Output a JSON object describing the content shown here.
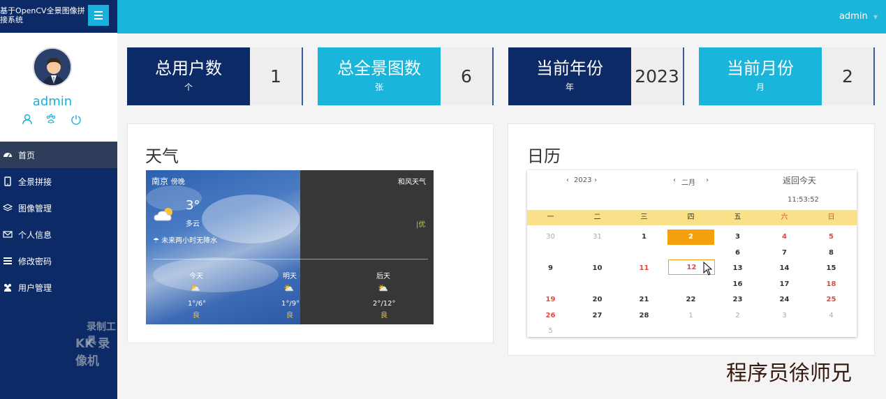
{
  "app": {
    "brand_title": "基于OpenCV全景图像拼接系统",
    "username": "admin"
  },
  "header": {
    "admin_menu": "admin"
  },
  "sidebar": {
    "items": [
      {
        "label": "首页",
        "icon": "dashboard-icon"
      },
      {
        "label": "全景拼接",
        "icon": "mobile-icon"
      },
      {
        "label": "图像管理",
        "icon": "layers-icon"
      },
      {
        "label": "个人信息",
        "icon": "envelope-icon"
      },
      {
        "label": "修改密码",
        "icon": "list-icon"
      },
      {
        "label": "用户管理",
        "icon": "users-icon"
      }
    ],
    "watermark_line1": "录制工具",
    "watermark_line2": "KK 录像机"
  },
  "stats": [
    {
      "label": "总用户数",
      "unit": "个",
      "value": "1",
      "color": "#0c2a66"
    },
    {
      "label": "总全景图数",
      "unit": "张",
      "value": "6",
      "color": "#19b5da"
    },
    {
      "label": "当前年份",
      "unit": "年",
      "value": "2023",
      "color": "#0c2a66"
    },
    {
      "label": "当前月份",
      "unit": "月",
      "value": "2",
      "color": "#19b5da"
    }
  ],
  "weather": {
    "panel_title": "天气",
    "city": "南京",
    "period": "傍晚",
    "provider": "和风天气",
    "temp": "3°",
    "condition": "多云",
    "rain_note": "未来两小时无降水",
    "aqi": "优",
    "forecast": [
      {
        "day": "今天",
        "range": "1°/6°",
        "aqi": "良"
      },
      {
        "day": "明天",
        "range": "1°/9°",
        "aqi": "良"
      },
      {
        "day": "后天",
        "range": "2°/12°",
        "aqi": "良"
      }
    ]
  },
  "calendar": {
    "panel_title": "日历",
    "year": "2023",
    "month": "二月",
    "back_today": "返回今天",
    "time": "11:53:52",
    "weekdays": [
      "一",
      "二",
      "三",
      "四",
      "五",
      "六",
      "日"
    ],
    "cells": [
      {
        "d": "30",
        "t": "other"
      },
      {
        "d": "31",
        "t": "other"
      },
      {
        "d": "1",
        "t": ""
      },
      {
        "d": "2",
        "t": "today"
      },
      {
        "d": "3",
        "t": ""
      },
      {
        "d": "4",
        "t": "weekend"
      },
      {
        "d": "5",
        "t": "weekend"
      },
      {
        "d": "6",
        "t": ""
      },
      {
        "d": "7",
        "t": ""
      },
      {
        "d": "8",
        "t": ""
      },
      {
        "d": "9",
        "t": ""
      },
      {
        "d": "10",
        "t": ""
      },
      {
        "d": "11",
        "t": "weekend"
      },
      {
        "d": "12",
        "t": "selected"
      },
      {
        "d": "13",
        "t": ""
      },
      {
        "d": "14",
        "t": ""
      },
      {
        "d": "15",
        "t": ""
      },
      {
        "d": "16",
        "t": ""
      },
      {
        "d": "17",
        "t": ""
      },
      {
        "d": "18",
        "t": "weekend"
      },
      {
        "d": "19",
        "t": "weekend"
      },
      {
        "d": "20",
        "t": ""
      },
      {
        "d": "21",
        "t": ""
      },
      {
        "d": "22",
        "t": ""
      },
      {
        "d": "23",
        "t": ""
      },
      {
        "d": "24",
        "t": ""
      },
      {
        "d": "25",
        "t": "weekend"
      },
      {
        "d": "26",
        "t": "weekend"
      },
      {
        "d": "27",
        "t": ""
      },
      {
        "d": "28",
        "t": ""
      },
      {
        "d": "1",
        "t": "other"
      },
      {
        "d": "2",
        "t": "other"
      },
      {
        "d": "3",
        "t": "other"
      },
      {
        "d": "4",
        "t": "other"
      },
      {
        "d": "5",
        "t": "other"
      }
    ]
  },
  "signature": "程序员徐师兄"
}
